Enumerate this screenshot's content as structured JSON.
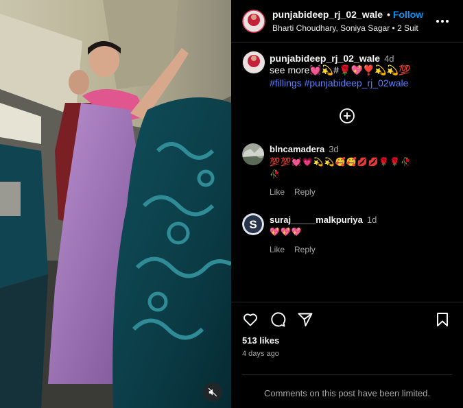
{
  "post": {
    "author": "punjabideep_rj_02_wale",
    "follow_label": "Follow",
    "subtitle": "Bharti Choudhary, Soniya Sagar • 2 Suit",
    "more_icon": "more-options-icon"
  },
  "caption": {
    "author": "punjabideep_rj_02_wale",
    "time": "4d",
    "text": "see more💓💫#🌹💖❣️💫💫💯",
    "tags": "#fillings #punjabideep_rj_02wale"
  },
  "comments": [
    {
      "author": "blncamadera",
      "time": "3d",
      "text_line1": "💯💯💓💗💫💫🥰🥰💋💋🌹🌹🥀",
      "text_line2": "🥀",
      "like_label": "Like",
      "reply_label": "Reply"
    },
    {
      "author": "suraj_____malkpuriya",
      "time": "1d",
      "text_line1": "💖💖💖",
      "like_label": "Like",
      "reply_label": "Reply"
    }
  ],
  "engagement": {
    "likes": "513 likes",
    "posted": "4 days ago",
    "icons": [
      "heart-icon",
      "comment-icon",
      "share-icon",
      "bookmark-icon"
    ]
  },
  "footer": {
    "limited_text": "Comments on this post have been limited."
  },
  "media": {
    "mute_icon": "mute-icon"
  },
  "colors": {
    "follow": "#0095f6",
    "hashtag": "#5b7fff",
    "muted_text": "#a8a8a8",
    "background": "#000000"
  }
}
